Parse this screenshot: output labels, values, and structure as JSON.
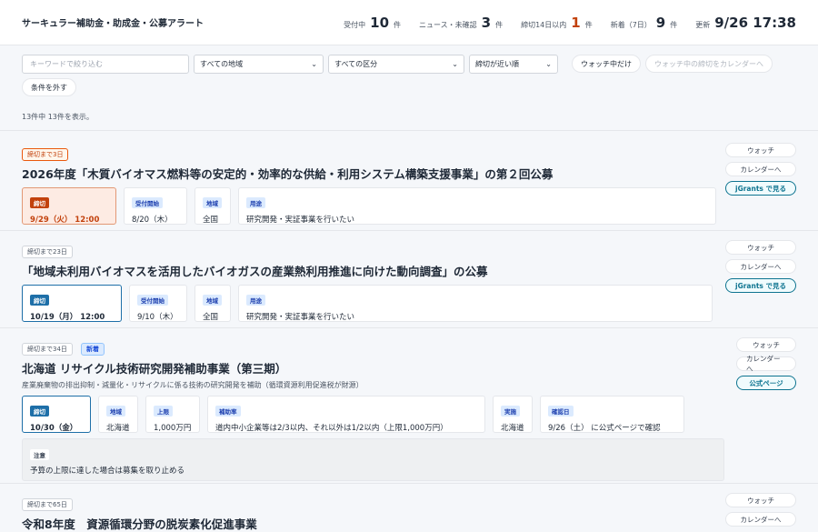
{
  "header": {
    "title": "サーキュラー補助金・助成金・公募アラート",
    "stats": [
      {
        "label": "受付中",
        "value": "10",
        "unit": "件"
      },
      {
        "label": "ニュース・未確認",
        "value": "3",
        "unit": "件"
      },
      {
        "label": "締切14日以内",
        "value": "1",
        "unit": "件"
      },
      {
        "label": "新着（7日）",
        "value": "9",
        "unit": "件"
      }
    ],
    "updated_label": "更新",
    "updated_value": "9/26 17:38",
    "accent": "#c2410c"
  },
  "filters": {
    "keyword_placeholder": "キーワードで絞り込む",
    "region": "すべての地域",
    "category": "すべての区分",
    "sort": "締切が近い順",
    "watch_only": "ウォッチ中だけ",
    "calendar_watch": "ウォッチ中の締切をカレンダーへ",
    "clear": "条件を外す"
  },
  "result_count": "13件中 13件を表示。",
  "cards": [
    {
      "deadline_tag": "締切まで3日",
      "title": "2026年度「木質バイオマス燃料等の安定的・効率的な供給・利用システム構築支援事業」の第２回公募",
      "boxes": [
        {
          "label": "締切",
          "value": "9/29（火） 12:00"
        },
        {
          "label": "受付開始",
          "value": "8/20（木）"
        },
        {
          "label": "地域",
          "value": "全国"
        },
        {
          "label": "用途",
          "value": "研究開発・実証事業を行いたい"
        }
      ],
      "actions": [
        "ウォッチ",
        "カレンダーへ",
        "jGrants で見る"
      ]
    },
    {
      "deadline_tag": "締切まで23日",
      "title": "「地域未利用バイオマスを活用したバイオガスの産業熱利用推進に向けた動向調査」の公募",
      "boxes": [
        {
          "label": "締切",
          "value": "10/19（月） 12:00"
        },
        {
          "label": "受付開始",
          "value": "9/10（木）"
        },
        {
          "label": "地域",
          "value": "全国"
        },
        {
          "label": "用途",
          "value": "研究開発・実証事業を行いたい"
        }
      ],
      "actions": [
        "ウォッチ",
        "カレンダーへ",
        "jGrants で見る"
      ]
    },
    {
      "deadline_tag": "締切まで34日",
      "new_tag": "新着",
      "title": "北海道 リサイクル技術研究開発補助事業（第三期）",
      "desc": "産業廃棄物の排出抑制・減量化・リサイクルに係る技術の研究開発を補助（循環資源利用促進税が財源）",
      "boxes": [
        {
          "label": "締切",
          "value": "10/30（金）"
        },
        {
          "label": "地域",
          "value": "北海道"
        },
        {
          "label": "上限",
          "value": "1,000万円"
        },
        {
          "label": "補助率",
          "value": "道内中小企業等は2/3以内、それ以外は1/2以内（上限1,000万円）"
        },
        {
          "label": "実施",
          "value": "北海道"
        },
        {
          "label": "確認日",
          "value": "9/26（土） に公式ページで確認"
        }
      ],
      "note": {
        "label": "注意",
        "value": "予算の上限に達した場合は募集を取り止める"
      },
      "actions": [
        "ウォッチ",
        "カレンダーへ",
        "公式ページ"
      ]
    },
    {
      "deadline_tag": "締切まで65日",
      "title": "令和8年度　資源循環分野の脱炭素化促進事業",
      "actions": [
        "ウォッチ",
        "カレンダーへ"
      ]
    }
  ]
}
